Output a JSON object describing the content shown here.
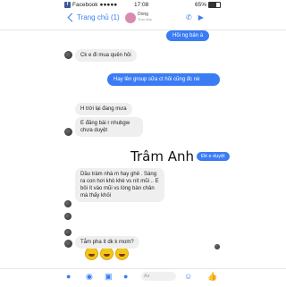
{
  "status_bar": {
    "carrier": "Facebook",
    "signal": "●●●●●",
    "time": "17:08",
    "battery": "65%"
  },
  "nav": {
    "back_label": "Trang chủ (1)",
    "contact_name": "Dong",
    "contact_status": "Trực tiếp"
  },
  "messages": [
    {
      "id": "m1",
      "text": "Hồi ng bán á",
      "side": "out"
    },
    {
      "id": "m2",
      "text": "Ck e đi mua quên hỏi",
      "side": "in"
    },
    {
      "id": "m3",
      "text": "Hay lên group sữa ct hỏi cũng đc nè",
      "side": "out"
    },
    {
      "id": "m4",
      "text": "H trời lại đang mưa",
      "side": "in"
    },
    {
      "id": "m5",
      "text": "E đăng bài r nhubgw chưa duyệt",
      "side": "in"
    },
    {
      "id": "m6",
      "text": "Dầu tràm nhà m hay ghê . Sáng ra con hơi khò khè vs nít mũi .. E bôi ít vào mũi vs lòng bàn chân mà thấy khỏi",
      "side": "in"
    },
    {
      "id": "m7",
      "text": "Tắm pha ít dk k mom?",
      "side": "in"
    }
  ],
  "shared_profile": {
    "name": "Trâm Anh",
    "follow_label": "Đề e duyệt"
  },
  "composer": {
    "placeholder": "Aa"
  }
}
